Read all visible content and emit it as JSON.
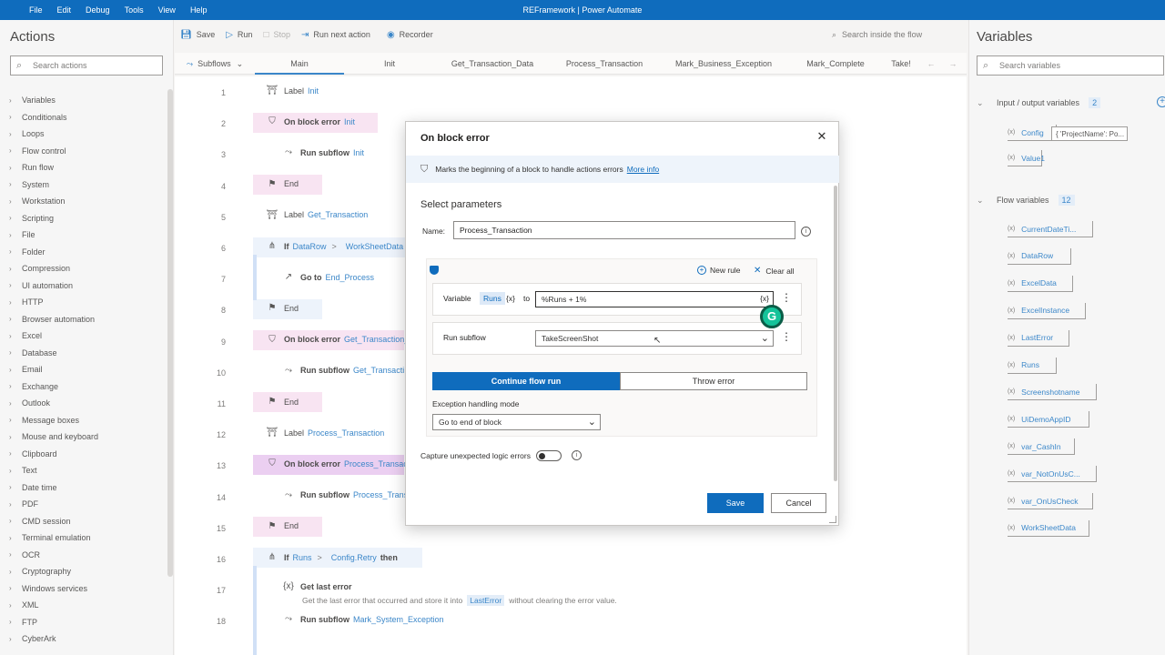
{
  "app": {
    "title": "REFramework | Power Automate"
  },
  "menu": [
    "File",
    "Edit",
    "Debug",
    "Tools",
    "View",
    "Help"
  ],
  "actions_panel": {
    "title": "Actions",
    "search_placeholder": "Search actions",
    "categories": [
      "Variables",
      "Conditionals",
      "Loops",
      "Flow control",
      "Run flow",
      "System",
      "Workstation",
      "Scripting",
      "File",
      "Folder",
      "Compression",
      "UI automation",
      "HTTP",
      "Browser automation",
      "Excel",
      "Database",
      "Email",
      "Exchange",
      "Outlook",
      "Message boxes",
      "Mouse and keyboard",
      "Clipboard",
      "Text",
      "Date time",
      "PDF",
      "CMD session",
      "Terminal emulation",
      "OCR",
      "Cryptography",
      "Windows services",
      "XML",
      "FTP",
      "CyberArk"
    ]
  },
  "toolbar": {
    "save": "Save",
    "run": "Run",
    "stop": "Stop",
    "run_next": "Run next action",
    "recorder": "Recorder",
    "search": "Search inside the flow"
  },
  "tabs": {
    "subflows": "Subflows",
    "items": [
      "Main",
      "Init",
      "Get_Transaction_Data",
      "Process_Transaction",
      "Mark_Business_Exception",
      "Mark_Complete",
      "Take!"
    ]
  },
  "flow": {
    "rows": [
      {
        "n": "1",
        "kw": "Label",
        "arg": "Init"
      },
      {
        "n": "2",
        "kw": "On block error",
        "arg": "Init"
      },
      {
        "n": "3",
        "kw": "Run subflow",
        "arg": "Init"
      },
      {
        "n": "4",
        "kw": "End",
        "arg": ""
      },
      {
        "n": "5",
        "kw": "Label",
        "arg": "Get_Transaction"
      },
      {
        "n": "6",
        "kw": "If",
        "arg": "DataRow",
        "op": ">",
        "arg2": "WorkSheetData"
      },
      {
        "n": "7",
        "kw": "Go to",
        "arg": "End_Process"
      },
      {
        "n": "8",
        "kw": "End",
        "arg": ""
      },
      {
        "n": "9",
        "kw": "On block error",
        "arg": "Get_Transaction_"
      },
      {
        "n": "10",
        "kw": "Run subflow",
        "arg": "Get_Transacti"
      },
      {
        "n": "11",
        "kw": "End",
        "arg": ""
      },
      {
        "n": "12",
        "kw": "Label",
        "arg": "Process_Transaction"
      },
      {
        "n": "13",
        "kw": "On block error",
        "arg": "Process_Transact"
      },
      {
        "n": "14",
        "kw": "Run subflow",
        "arg": "Process_Transa"
      },
      {
        "n": "15",
        "kw": "End",
        "arg": ""
      },
      {
        "n": "16",
        "kw": "If",
        "arg": "Runs",
        "op": ">",
        "arg2": "Config",
        "arg3": ".Retry",
        "then": "then"
      },
      {
        "n": "17",
        "kw": "Get last error",
        "arg": "",
        "desc1": "Get the last error that occurred and store it into",
        "desc_var": "LastError",
        "desc2": "without clearing the error value."
      },
      {
        "n": "18",
        "kw": "Run subflow",
        "arg": "Mark_System_Exception"
      }
    ]
  },
  "variables_panel": {
    "title": "Variables",
    "search_placeholder": "Search variables",
    "io_title": "Input / output variables",
    "io_count": "2",
    "io_vars": [
      {
        "name": "Config",
        "value": "{ 'ProjectName': Po..."
      },
      {
        "name": "Value1",
        "value": ""
      }
    ],
    "flow_title": "Flow variables",
    "flow_count": "12",
    "flow_vars": [
      "CurrentDateTi...",
      "DataRow",
      "ExcelData",
      "ExcelInstance",
      "LastError",
      "Runs",
      "Screenshotname",
      "UiDemoAppID",
      "var_CashIn",
      "var_NotOnUsC...",
      "var_OnUsCheck",
      "WorkSheetData"
    ]
  },
  "dialog": {
    "title": "On block error",
    "info": "Marks the beginning of a block to handle actions errors",
    "more_info": "More info",
    "section": "Select parameters",
    "name_label": "Name:",
    "name_value": "Process_Transaction",
    "new_rule": "New rule",
    "clear_all": "Clear all",
    "variable_label": "Variable",
    "variable_chip": "Runs",
    "fx": "{x}",
    "to_label": "to",
    "expr_value": "%Runs + 1%",
    "run_subflow_label": "Run subflow",
    "subflow_value": "TakeScreenShot",
    "continue": "Continue flow run",
    "throw": "Throw error",
    "mode_label": "Exception handling mode",
    "mode_value": "Go to end of block",
    "capture_label": "Capture unexpected logic errors",
    "save": "Save",
    "cancel": "Cancel"
  },
  "colors": {
    "accent": "#0f6cbd",
    "grammarly": "#15c39a"
  }
}
